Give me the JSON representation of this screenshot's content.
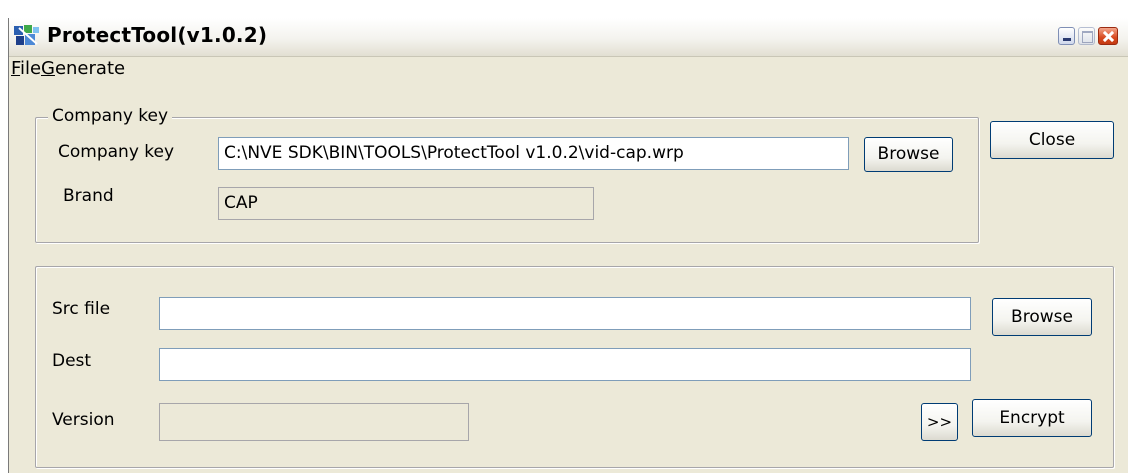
{
  "window": {
    "title": "ProtectTool(v1.0.2)",
    "icon": "app-icon"
  },
  "menu": {
    "file": {
      "accel": "F",
      "rest": "ile"
    },
    "generate": {
      "accel": "G",
      "rest": "enerate"
    }
  },
  "company_group": {
    "legend": "Company key",
    "company_key_label": "Company key",
    "company_key_value": "C:\\NVE SDK\\BIN\\TOOLS\\ProtectTool v1.0.2\\vid-cap.wrp",
    "browse_label": "Browse",
    "brand_label": "Brand",
    "brand_value": "CAP"
  },
  "close_label": "Close",
  "file_group": {
    "src_label": "Src file",
    "src_value": "",
    "dest_label": "Dest",
    "dest_value": "",
    "version_label": "Version",
    "version_value": "",
    "browse_label": "Browse",
    "more_label": ">>",
    "encrypt_label": "Encrypt"
  }
}
